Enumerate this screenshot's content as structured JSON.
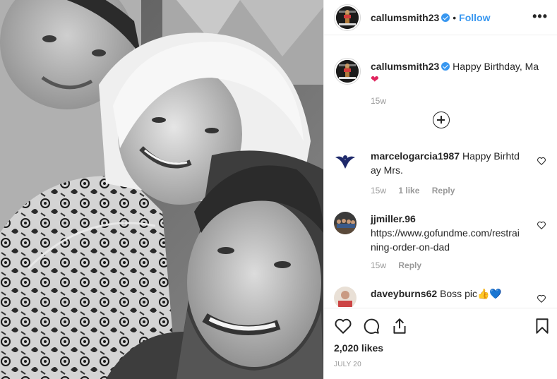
{
  "post": {
    "username": "callumsmith23",
    "follow_label": "Follow",
    "separator": "•",
    "more_label": "•••",
    "photo_alt": "Black and white selfie of three people"
  },
  "caption": {
    "username": "callumsmith23",
    "text": "Happy Birthday, Ma",
    "emoji": "❤",
    "timestamp": "15w"
  },
  "comments": [
    {
      "username": "marcelogarcia1987",
      "text": "Happy Birhtday Mrs.",
      "time": "15w",
      "likes": "1 like",
      "reply": "Reply"
    },
    {
      "username": "jjmiller.96",
      "text": "https://www.gofundme.com/restraining-order-on-dad",
      "time": "15w",
      "reply": "Reply"
    },
    {
      "username": "daveyburns62",
      "text": "Boss pic",
      "emoji": "👍💙"
    }
  ],
  "actions": {
    "likes": "2,020 likes",
    "date": "JULY 20"
  },
  "icons": [
    "heart-icon",
    "comment-icon",
    "share-icon",
    "bookmark-icon",
    "add-comment-icon",
    "more-options-icon",
    "verified-badge-icon"
  ],
  "colors": {
    "link": "#3897f0",
    "verified": "#3897f0",
    "meta": "#999999",
    "heart": "#e0245e"
  }
}
